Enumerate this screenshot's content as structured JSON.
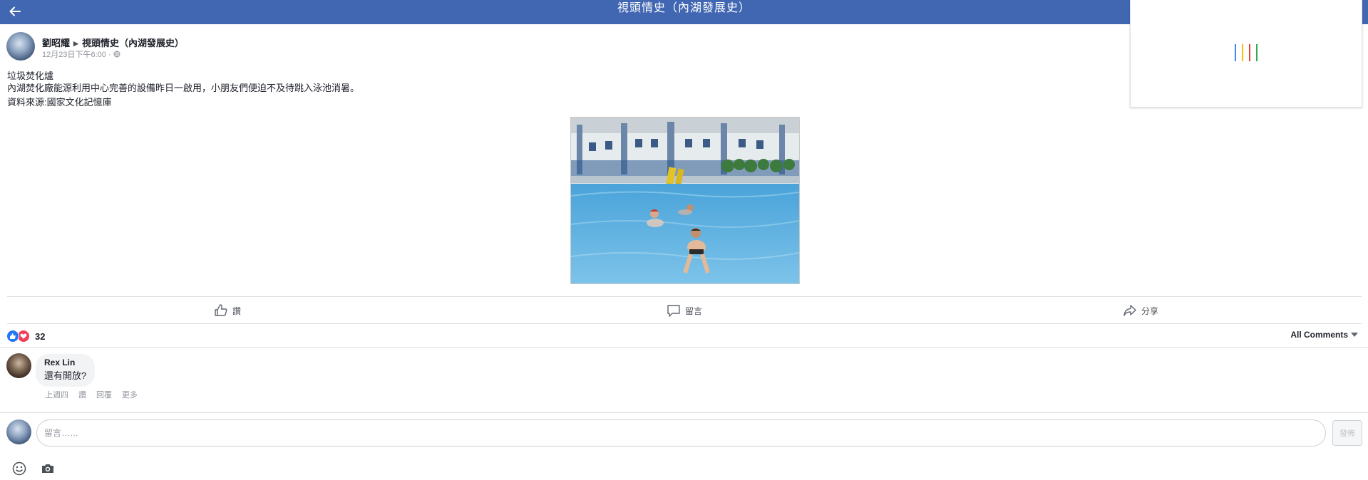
{
  "topbar": {
    "title": "視頭情史（內湖發展史）",
    "back_icon": "arrow-left-icon",
    "background": "#4267b2"
  },
  "popup": {
    "loader_colors": [
      "#4285f4",
      "#fbbc05",
      "#ea4335",
      "#34a853"
    ]
  },
  "post": {
    "author": "劉昭耀",
    "group": "視頭情史（內湖發展史）",
    "timestamp": "12月23日下午6:00",
    "meta_separator": "·",
    "privacy_icon": "globe-icon",
    "lines": [
      "垃圾焚化爐",
      "內湖焚化廠能源利用中心完善的設備昨日一啟用，小朋友們便迫不及待跳入泳池消暑。"
    ],
    "source": "資料來源:國家文化記憶庫"
  },
  "actions": {
    "like": "讚",
    "comment": "留言",
    "share": "分享"
  },
  "reactions": {
    "count": "32",
    "types": [
      "like",
      "love"
    ],
    "like_color": "#2078f4",
    "love_color": "#f33e58"
  },
  "comments_filter": "All Comments",
  "comments": [
    {
      "name": "Rex Lin",
      "text": "還有開放?",
      "time": "上週四",
      "like": "讚",
      "reply": "回覆",
      "more": "更多"
    }
  ],
  "composer": {
    "placeholder": "留言……",
    "post_button": "發佈",
    "emoji_icon": "smiley-icon",
    "camera_icon": "camera-icon"
  }
}
